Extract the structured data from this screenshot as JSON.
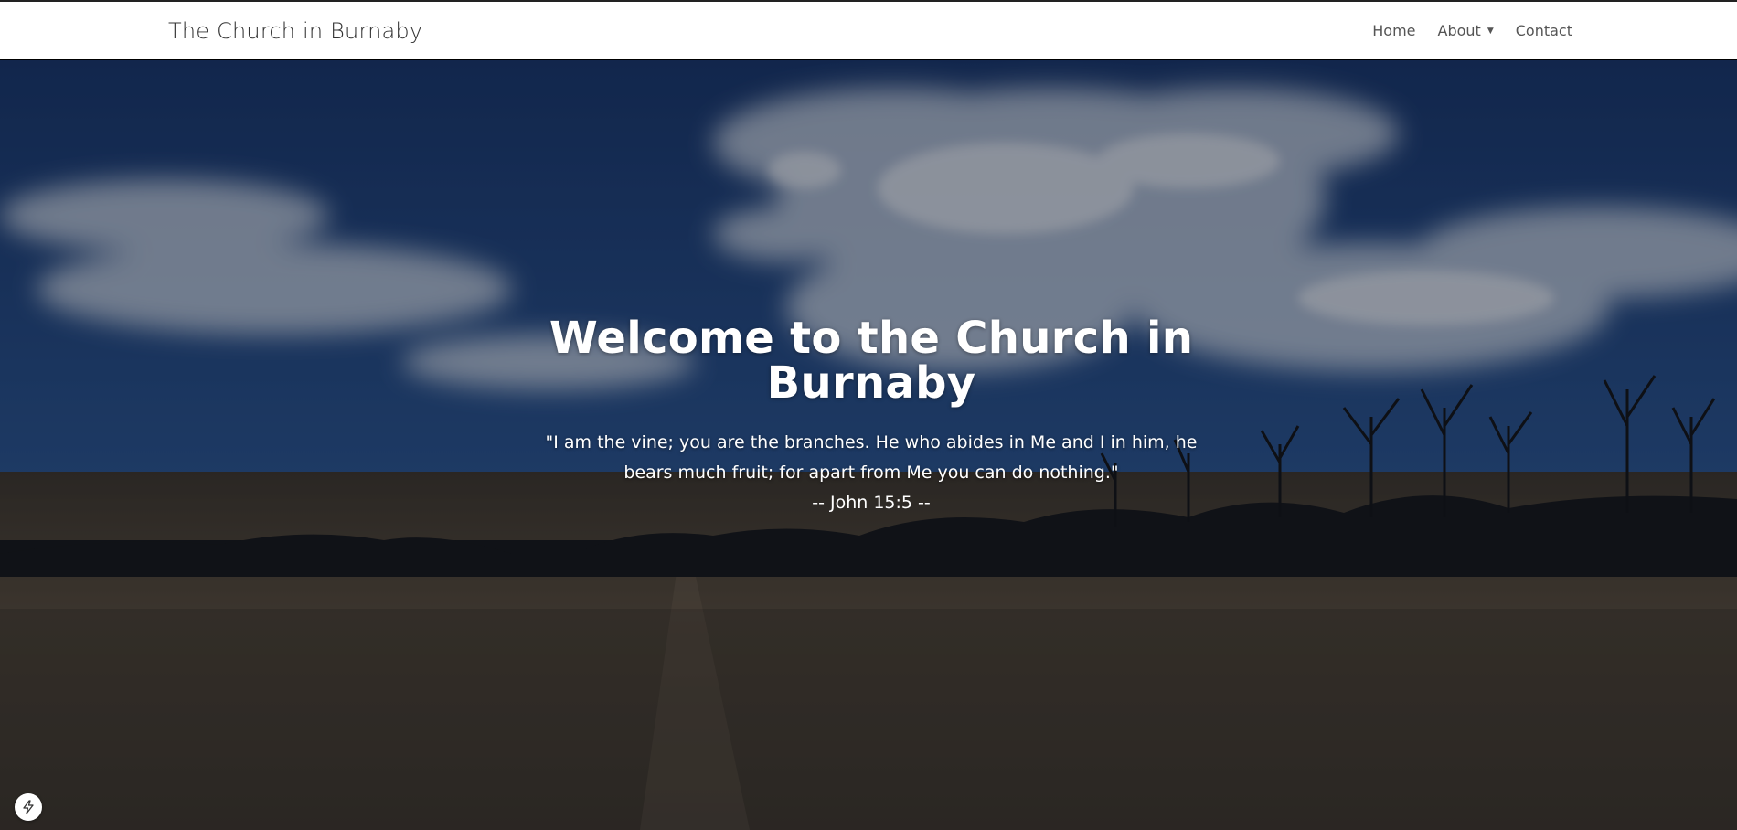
{
  "nav": {
    "brand": "The Church in Burnaby",
    "links": [
      {
        "label": "Home"
      },
      {
        "label": "About",
        "has_dropdown": true
      },
      {
        "label": "Contact"
      }
    ]
  },
  "hero": {
    "title": "Welcome to the Church in Burnaby",
    "quote": "\"I am the vine; you are the branches. He who abides in Me and I in him, he bears much fruit; for apart from Me you can do nothing.\"",
    "reference": "-- John 15:5 --"
  },
  "icons": {
    "dropdown": "caret-down-icon",
    "badge": "lightning-icon"
  },
  "colors": {
    "sky": "#1d3a66",
    "field": "#4a4030",
    "nav_text": "#555555",
    "brand_text": "#333333"
  }
}
